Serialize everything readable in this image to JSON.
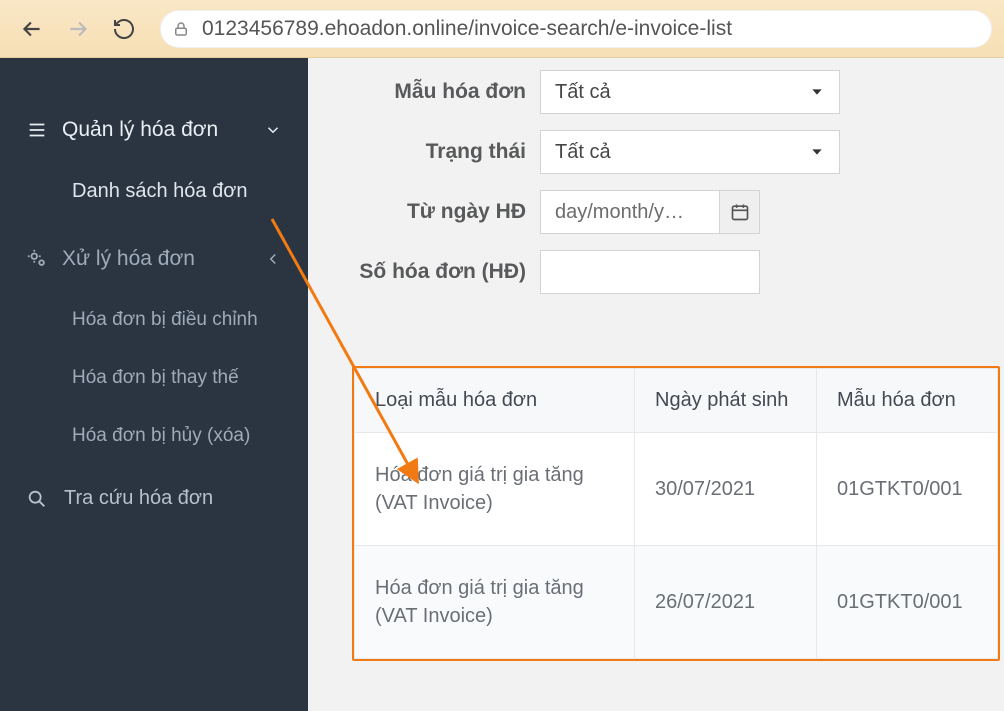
{
  "browser": {
    "url": "0123456789.ehoadon.online/invoice-search/e-invoice-list"
  },
  "sidebar": {
    "section1": {
      "label": "Quản lý hóa đơn"
    },
    "section1_sub1": {
      "label": "Danh sách hóa đơn"
    },
    "section2": {
      "label": "Xử lý hóa đơn"
    },
    "section2_sub1": {
      "label": "Hóa đơn bị điều chỉnh"
    },
    "section2_sub2": {
      "label": "Hóa đơn bị thay thế"
    },
    "section2_sub3": {
      "label": "Hóa đơn bị hủy (xóa)"
    },
    "search": {
      "label": "Tra cứu hóa đơn"
    }
  },
  "filters": {
    "template": {
      "label": "Mẫu hóa đơn",
      "value": "Tất cả"
    },
    "status": {
      "label": "Trạng thái",
      "value": "Tất cả"
    },
    "fromdate": {
      "label": "Từ ngày HĐ",
      "placeholder": "day/month/y…"
    },
    "number": {
      "label": "Số hóa đơn (HĐ)",
      "value": ""
    }
  },
  "table": {
    "headers": {
      "type": "Loại mẫu hóa đơn",
      "date": "Ngày phát sinh",
      "template": "Mẫu hóa đơn"
    },
    "rows": [
      {
        "type": "Hóa đơn giá trị gia tăng (VAT Invoice)",
        "date": "30/07/2021",
        "template": "01GTKT0/001"
      },
      {
        "type": "Hóa đơn giá trị gia tăng (VAT Invoice)",
        "date": "26/07/2021",
        "template": "01GTKT0/001"
      }
    ]
  },
  "colors": {
    "sidebar_bg": "#2a3541",
    "accent_orange": "#f27a13"
  }
}
